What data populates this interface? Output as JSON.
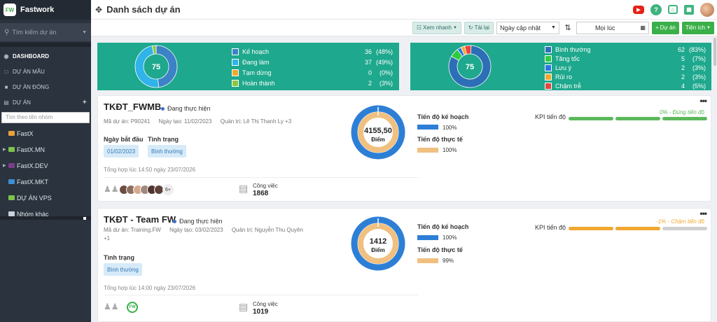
{
  "app": {
    "name": "Fastwork",
    "logo_text": "FW"
  },
  "sidebar": {
    "search_placeholder": "Tìm kiếm dự án",
    "nav": [
      {
        "label": "DASHBOARD"
      },
      {
        "label": "DỰ ÁN MẪU"
      },
      {
        "label": "DỰ ÁN ĐÓNG"
      },
      {
        "label": "DỰ ÁN"
      }
    ],
    "group_search_placeholder": "Tìm theo tên nhóm",
    "folders": [
      {
        "label": "FastX",
        "color": "#e8a23a"
      },
      {
        "label": "FastX.MN",
        "color": "#7dc24b"
      },
      {
        "label": "FastX.DEV",
        "color": "#7a3d8c"
      },
      {
        "label": "FastX.MKT",
        "color": "#3b8fd6"
      },
      {
        "label": "DỰ ÁN VPS",
        "color": "#7dc24b"
      },
      {
        "label": "Nhóm khác",
        "color": "#c9d1d9"
      }
    ]
  },
  "header": {
    "title": "Danh sách dự án"
  },
  "toolbar": {
    "quick_view": "Xem nhanh",
    "reload": "Tải lại",
    "sort_select": "Ngày cập nhật",
    "date_filter": "Mọi lúc",
    "add_project": "Dự án",
    "utilities": "Tiện ích"
  },
  "stats_status": {
    "total": "75",
    "items": [
      {
        "name": "Kế hoạch",
        "value": "36",
        "pct": "(48%)",
        "color": "#3b82c6"
      },
      {
        "name": "Đang làm",
        "value": "37",
        "pct": "(49%)",
        "color": "#2fb3e8"
      },
      {
        "name": "Tạm dừng",
        "value": "0",
        "pct": "(0%)",
        "color": "#f0a830"
      },
      {
        "name": "Hoàn thành",
        "value": "2",
        "pct": "(3%)",
        "color": "#8cc63f"
      }
    ],
    "fractions": [
      0.48,
      0.49,
      0.0,
      0.03
    ]
  },
  "stats_health": {
    "total": "75",
    "items": [
      {
        "name": "Bình thường",
        "value": "62",
        "pct": "(83%)",
        "color": "#2d6fb6"
      },
      {
        "name": "Tăng tốc",
        "value": "5",
        "pct": "(7%)",
        "color": "#2ecc40"
      },
      {
        "name": "Lưu ý",
        "value": "2",
        "pct": "(3%)",
        "color": "#2a74e8"
      },
      {
        "name": "Rủi ro",
        "value": "2",
        "pct": "(3%)",
        "color": "#f0a830"
      },
      {
        "name": "Chậm trễ",
        "value": "4",
        "pct": "(5%)",
        "color": "#e8453c"
      }
    ],
    "fractions": [
      0.83,
      0.07,
      0.03,
      0.03,
      0.05
    ]
  },
  "projects": [
    {
      "title": "TKĐT_FWMB",
      "status": "Đang thực hiện",
      "code": "Mã dự án: P90241",
      "created": "Ngày tạo: 11/02/2023",
      "manager": "Quản trị: Lê Thị Thanh Ly +3",
      "start_label": "Ngày bắt đầu",
      "start_value": "01/02/2023",
      "state_label": "Tình trạng",
      "state_value": "Bình thường",
      "summary": "Tổng hợp lúc 14:50 ngày 23/07/2026",
      "members_more": "6+",
      "task_label": "Công việc",
      "task_value": "1868",
      "score": "4155,50",
      "score_unit": "Điểm",
      "plan_label": "Tiến độ kế hoạch",
      "plan_value": "100%",
      "plan_fraction": 1.0,
      "actual_label": "Tiến độ thực tế",
      "actual_value": "100%",
      "actual_fraction": 1.0,
      "kpi_label": "KPI tiến độ",
      "kpi_pct": "0%",
      "kpi_note": " - Đúng tiến độ",
      "kpi_color": "#5cb85c"
    },
    {
      "title": "TKĐT - Team FW",
      "status": "Đang thực hiện",
      "code": "Mã dự án: Training.FW",
      "created": "Ngày tạo: 03/02/2023",
      "manager": "Quản trị: Nguyễn Thu Quyên",
      "manager_more": "+1",
      "state_label": "Tình trạng",
      "state_value": "Bình thường",
      "summary": "Tổng hợp lúc 14:00 ngày 23/07/2026",
      "task_label": "Công việc",
      "task_value": "1019",
      "score": "1412",
      "score_unit": "Điểm",
      "plan_label": "Tiến độ kế hoạch",
      "plan_value": "100%",
      "plan_fraction": 1.0,
      "actual_label": "Tiến độ thực tế",
      "actual_value": "99%",
      "actual_fraction": 0.99,
      "kpi_label": "KPI tiến độ",
      "kpi_pct": "-1%",
      "kpi_note": " - Chậm tiến độ",
      "kpi_color": "#f0a830"
    }
  ]
}
